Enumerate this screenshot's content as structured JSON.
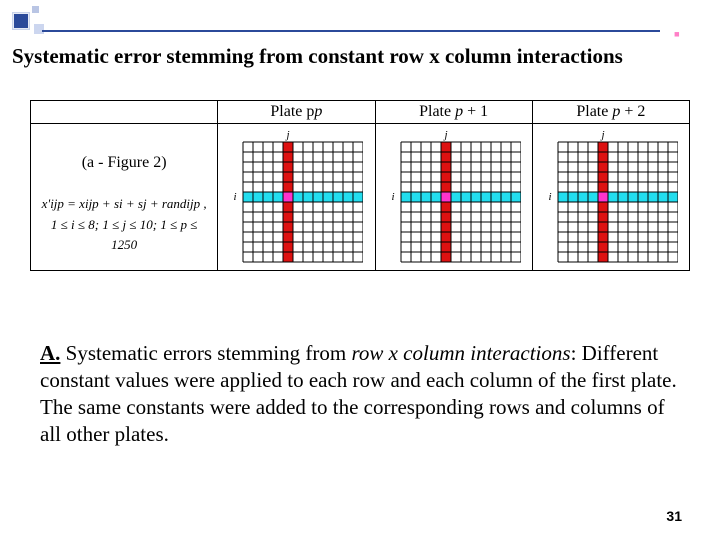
{
  "title": "Systematic error stemming from constant row x column interactions",
  "figure": {
    "left_header": "",
    "plates": [
      "Plate p",
      "Plate p + 1",
      "Plate p + 2"
    ],
    "left_label": "(a - Figure 2)",
    "formula_line1": "x'ijp = xijp + si + sj + randijp ,",
    "formula_line2": "1 ≤ i ≤ 8; 1 ≤ j ≤ 10; 1 ≤ p ≤ 1250",
    "axis_i": "i",
    "axis_j": "j",
    "grid": {
      "rows": 12,
      "cols": 12,
      "hl_row": 5,
      "hl_col": 4
    }
  },
  "body": {
    "section_label": "A.",
    "lead": " Systematic errors stemming from ",
    "italic_span": "row x column interactions",
    "rest": ": Different constant values were applied to each row and each column of the first plate. The same constants were added to the corresponding rows and columns of all other plates."
  },
  "page_number": "31"
}
